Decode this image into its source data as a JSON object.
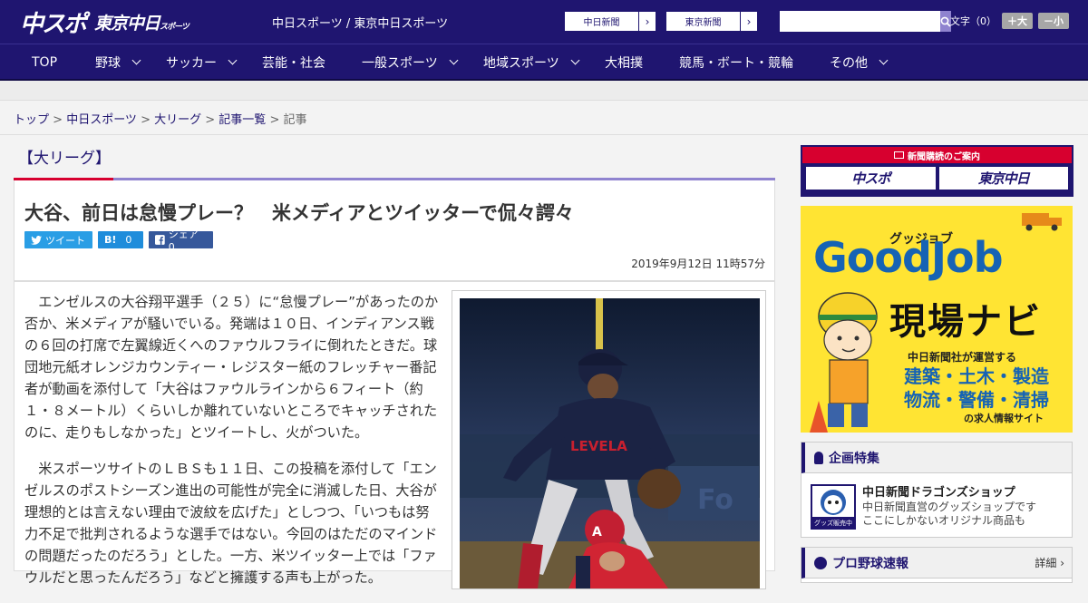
{
  "header": {
    "logo_main": "中スポ",
    "logo_tokyo": "東京中日",
    "logo_tokyo_sub": "スポーツ",
    "site_title": "中日スポーツ / 東京中日スポーツ",
    "paper_links": [
      "中日新聞",
      "東京新聞"
    ],
    "search_placeholder": "",
    "fontsize_label": "文字（0）",
    "fontsize_increase": "＋大",
    "fontsize_decrease": "－小"
  },
  "nav": [
    {
      "label": "TOP",
      "dropdown": false
    },
    {
      "label": "野球",
      "dropdown": true
    },
    {
      "label": "サッカー",
      "dropdown": true
    },
    {
      "label": "芸能・社会",
      "dropdown": false
    },
    {
      "label": "一般スポーツ",
      "dropdown": true
    },
    {
      "label": "地域スポーツ",
      "dropdown": true
    },
    {
      "label": "大相撲",
      "dropdown": false
    },
    {
      "label": "競馬・ボート・競輪",
      "dropdown": false
    },
    {
      "label": "その他",
      "dropdown": true
    }
  ],
  "breadcrumb": {
    "items": [
      "トップ",
      "中日スポーツ",
      "大リーグ",
      "記事一覧"
    ],
    "current": "記事",
    "sep": " > "
  },
  "article": {
    "category": "【大リーグ】",
    "headline": "大谷、前日は怠慢プレー？　米メディアとツイッターで侃々諤々",
    "share": {
      "tweet": "ツイート",
      "hatena": "0",
      "facebook": "シェア 0"
    },
    "date": "2019年9月12日 11時57分",
    "paragraphs": [
      "エンゼルスの大谷翔平選手（２５）に“怠慢プレー”があったのか否か、米メディアが騒いでいる。発端は１０日、インディアンス戦の６回の打席で左翼線近くへのファウルフライに倒れたときだ。球団地元紙オレンジカウンティー・レジスター紙のフレッチャー番記者が動画を添付して「大谷はファウルラインから６フィート（約１・８メートル）くらいしか離れていないところでキャッチされたのに、走りもしなかった」とツイートし、火がついた。",
      "米スポーツサイトのＬＢＳも１１日、この投稿を添付して「エンゼルスのポストシーズン進出の可能性が完全に消滅した日、大谷が理想的とは言えない理由で波紋を広げた」としつつ、「いつもは努力不足で批判されるような選手ではない。今回のはただのマインドの問題だったのだろう」とした。一方、米ツイッター上では「ファウルだと思ったんだろう」などと擁護する声も上がった。"
    ]
  },
  "sidebar": {
    "subscribe_title": "新聞購読のご案内",
    "subscribe_logos": [
      "中スポ",
      "東京中日"
    ],
    "ad": {
      "brand": "GoodJob",
      "brand_kana": "グッジョブ",
      "title": "現場ナビ",
      "operator": "中日新聞社が運営する",
      "fields": [
        "建築・土木・製造",
        "物流・警備・清掃"
      ],
      "tagline": "の求人情報サイト"
    },
    "feature": {
      "heading": "企画特集",
      "title": "中日新聞ドラゴンズショップ",
      "desc1": "中日新聞直営のグッズショップです",
      "desc2": "ここにしかないオリジナル商品も",
      "badge": "グッズ販売中"
    },
    "baseball": {
      "heading": "プロ野球速報",
      "more": "詳細 ›"
    }
  }
}
